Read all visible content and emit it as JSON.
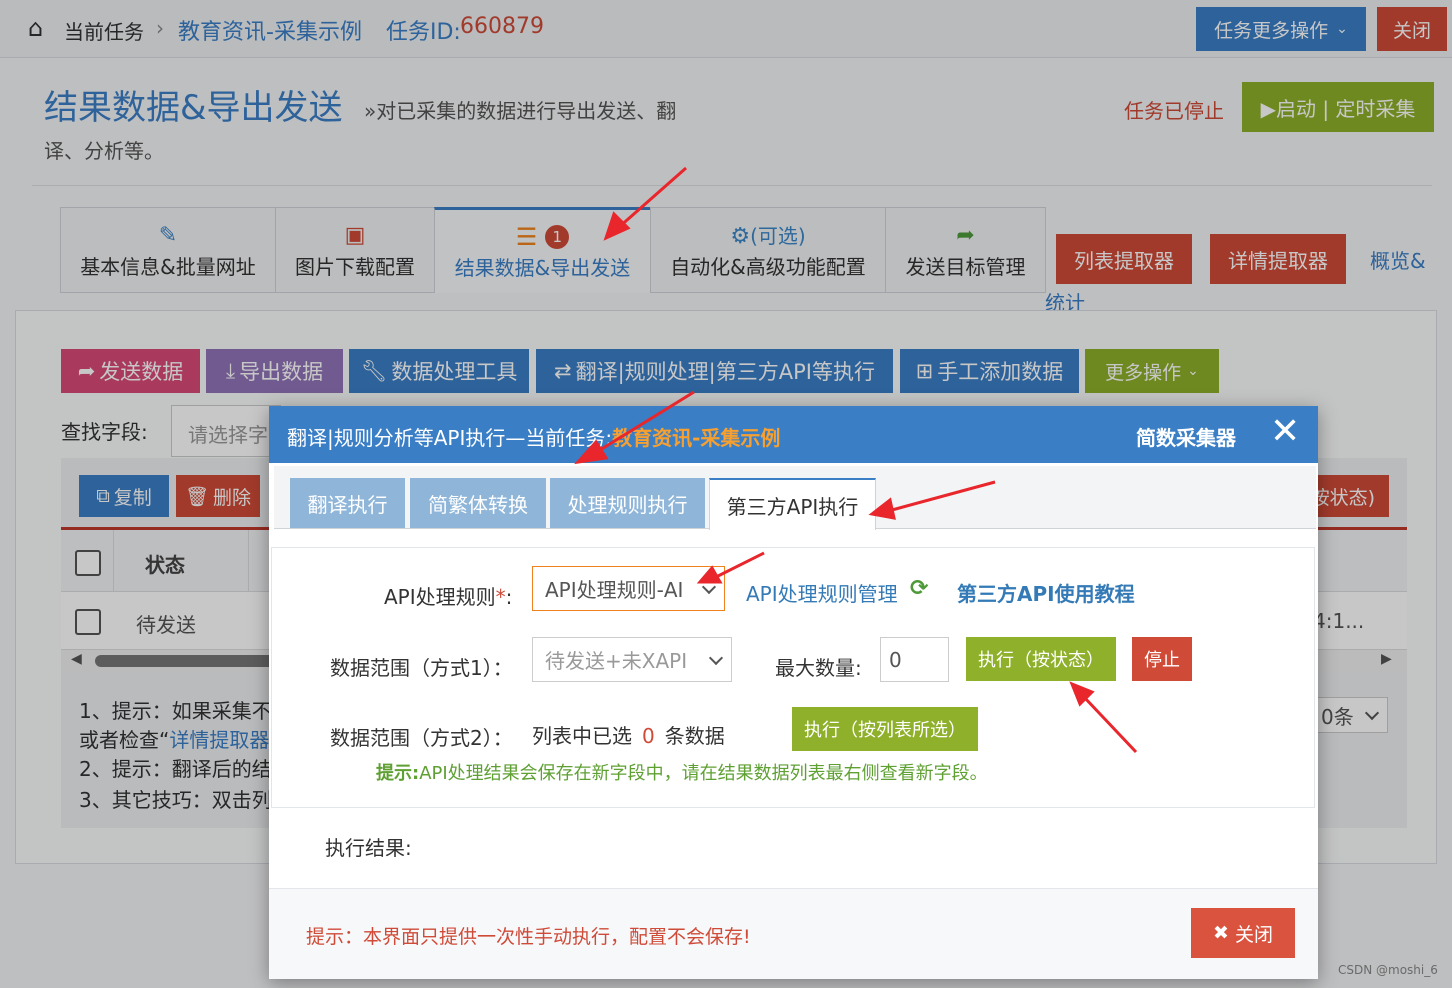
{
  "top_bar": {
    "home_label": "当前任务",
    "task_name": "教育资讯-采集示例",
    "task_id_prefix": "任务ID:",
    "task_id": "660879",
    "more_ops": "任务更多操作",
    "close": "关闭"
  },
  "header": {
    "title": "结果数据&导出发送",
    "subtitle_a": "»对已采集的数据进行导出发送、翻",
    "subtitle_b": "译、分析等。",
    "status": "任务已停止",
    "start_button": "▶启动 | 定时采集"
  },
  "main_tabs": [
    {
      "label": "基本信息&批量网址",
      "icon": "edit-icon"
    },
    {
      "label": "图片下载配置",
      "icon": "image-icon"
    },
    {
      "label": "结果数据&导出发送",
      "icon": "database-icon",
      "badge": "1"
    },
    {
      "label": "自动化&高级功能配置",
      "icon": "gears-icon",
      "icon_text": "(可选)"
    },
    {
      "label": "发送目标管理",
      "icon": "share-icon"
    }
  ],
  "side_buttons": {
    "list_extractor": "列表提取器",
    "detail_extractor": "详情提取器",
    "overview_a": "概览&",
    "overview_b": "统计"
  },
  "toolbar": {
    "send": "发送数据",
    "export": "导出数据",
    "tools": "数据处理工具",
    "translate": "翻译|规则处理|第三方API等执行",
    "add": "手工添加数据",
    "more": "更多操作"
  },
  "search": {
    "label": "查找字段:",
    "placeholder": "请选择字"
  },
  "table_toolbar": {
    "copy": "复制",
    "delete": "删除",
    "right_partial": "按状态)"
  },
  "table": {
    "header_status": "状态",
    "row_status": "待发送",
    "row_partial": "4:1..."
  },
  "tips": {
    "line1": "1、提示：如果采集不",
    "line2_a": "或者检查“",
    "line2_b": "详情提取器",
    "line3": "2、提示：翻译后的结",
    "line4": "3、其它技巧：双击列",
    "page_size_partial": "0条"
  },
  "modal": {
    "title_prefix": "翻译|规则分析等API执行—当前任务:",
    "title_task": "教育资讯-采集示例",
    "brand": "简数采集器",
    "tabs": [
      "翻译执行",
      "简繁体转换",
      "处理规则执行",
      "第三方API执行"
    ],
    "api_rule_label": "API处理规则",
    "required_mark": "*",
    "colon": ":",
    "api_rule_value": "API处理规则-AI",
    "api_rule_manage": "API处理规则管理",
    "api_tutorial": "第三方API使用教程",
    "range1_label": "数据范围（方式1）：",
    "range1_value": "待发送+未XAPI",
    "max_label": "最大数量:",
    "max_value": "0",
    "exec_by_status": "执行（按状态）",
    "stop": "停止",
    "range2_label": "数据范围（方式2）：",
    "range2_text_a": "列表中已选",
    "range2_count": "0",
    "range2_text_b": "条数据",
    "exec_by_selection": "执行（按列表所选）",
    "hint_label": "提示:",
    "hint_text": "API处理结果会保存在新字段中，请在结果数据列表最右侧查看新字段。",
    "result_label": "执行结果:",
    "footer_tip": "提示：本界面只提供一次性手动执行，配置不会保存!",
    "close": "关闭"
  },
  "watermark": "CSDN @moshi_6",
  "colors": {
    "primary_blue": "#3a7ec6",
    "danger_red": "#cf4b38",
    "green": "#8fb02b",
    "orange": "#f0821e",
    "link_blue": "#337ab7"
  }
}
